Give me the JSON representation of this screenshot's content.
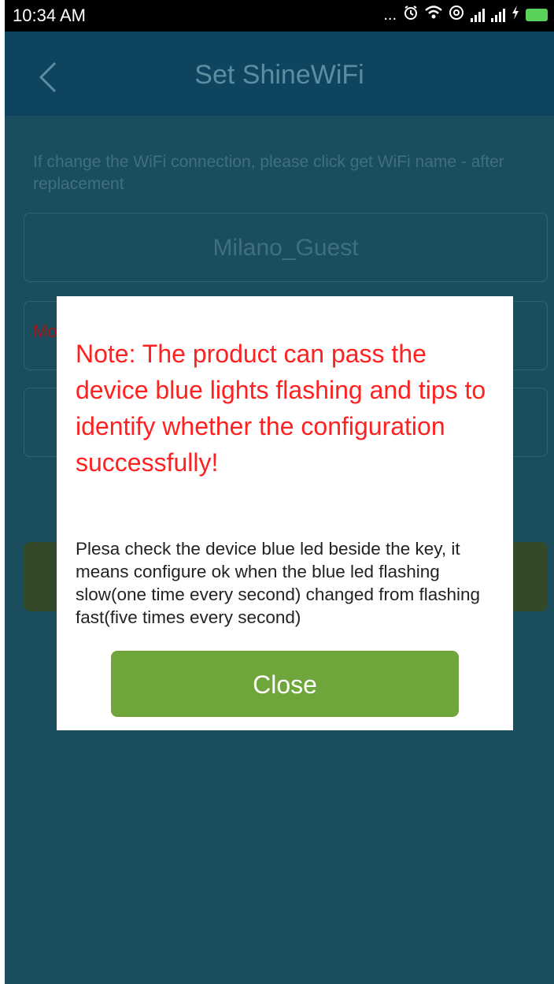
{
  "status_bar": {
    "time": "10:34 AM",
    "dots": "...",
    "alarm_icon": "alarm-clock-icon",
    "wifi_icon": "wifi-icon",
    "at_icon": "at-sign-icon",
    "signal_icon": "signal-bars-icon",
    "battery_icon": "battery-charging-icon"
  },
  "header": {
    "title": "Set ShineWiFi",
    "back_icon": "chevron-left-icon"
  },
  "form": {
    "hint": "If change the WiFi connection, please click get WiFi name - after replacement",
    "ssid_value": "Milano_Guest",
    "password_label_partial": "Mo"
  },
  "dialog": {
    "note": "Note: The product can pass the device blue lights flashing and tips to identify whether the configuration successfully!",
    "body": "Plesa check the device blue led beside the key, it means configure ok when the blue led flashing slow(one time every second) changed from flashing fast(five times every second)",
    "close_label": "Close"
  },
  "colors": {
    "background": "#1a4d5e",
    "header": "#0f4461",
    "note_text": "#ff2020",
    "close_button": "#6fa63b"
  }
}
